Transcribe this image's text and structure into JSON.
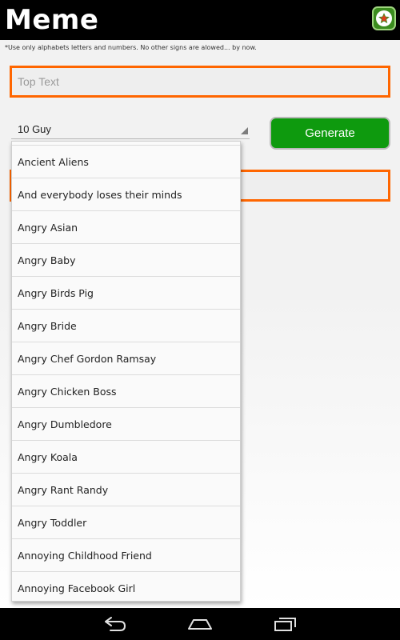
{
  "app": {
    "title": "Meme",
    "favorites_icon": "star-icon"
  },
  "colors": {
    "action_bar": "#000000",
    "field_border": "#ff6600",
    "generate_button": "#0e9a0e",
    "favorites_button": "#3b8c1e"
  },
  "form": {
    "hint": "*Use only alphabets letters and numbers. No other signs are alowed... by now.",
    "top_text_placeholder": "Top Text",
    "bottom_text_placeholder": "",
    "template_selected": "10 Guy",
    "generate_label": "Generate"
  },
  "dropdown": {
    "items": [
      "Ancient Aliens",
      "And everybody loses their minds",
      "Angry Asian",
      "Angry Baby",
      "Angry Birds Pig",
      "Angry Bride",
      "Angry Chef Gordon Ramsay",
      "Angry Chicken Boss",
      "Angry Dumbledore",
      "Angry Koala",
      "Angry Rant Randy",
      "Angry Toddler",
      "Annoying Childhood Friend",
      "Annoying Facebook Girl"
    ]
  },
  "nav": {
    "back_icon": "back-icon",
    "home_icon": "home-icon",
    "recents_icon": "recents-icon"
  }
}
